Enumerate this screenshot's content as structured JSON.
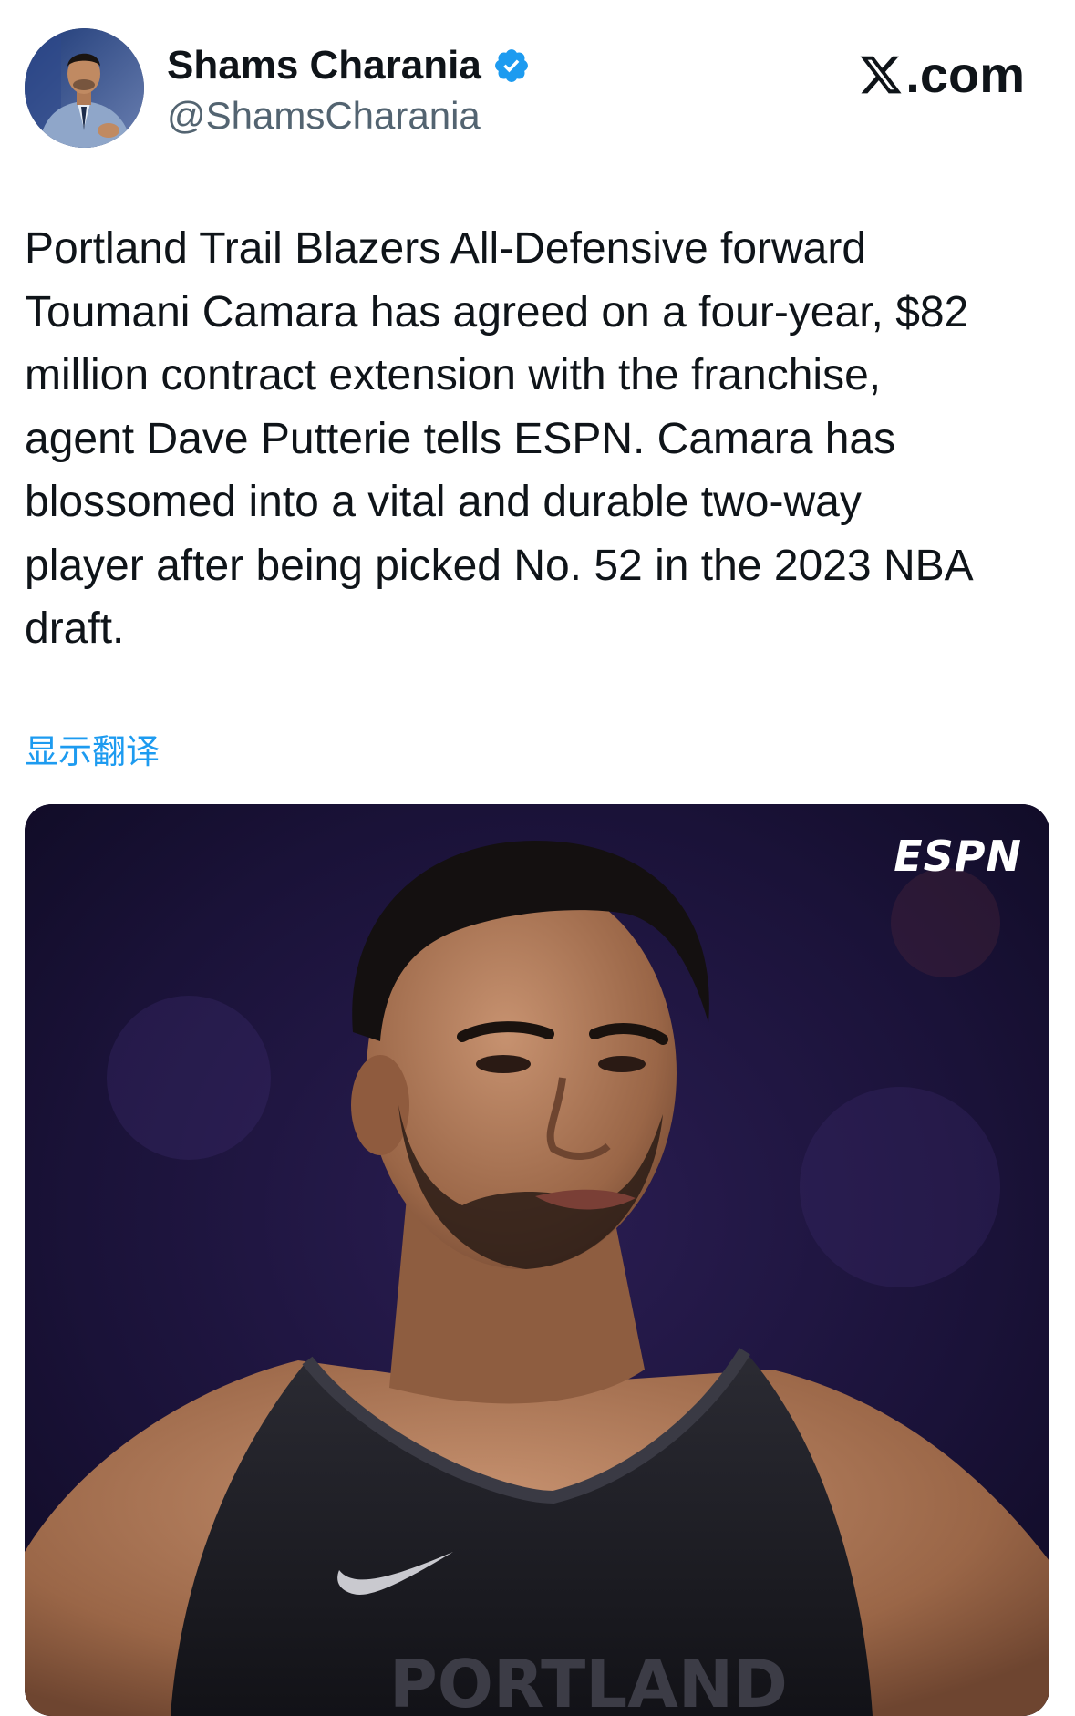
{
  "author": {
    "display_name": "Shams Charania",
    "handle": "@ShamsCharania",
    "verified": true,
    "avatar_icon": "profile-photo"
  },
  "brand": {
    "site_label": ".com",
    "logo_icon": "x-logo-icon"
  },
  "tweet": {
    "text": "Portland Trail Blazers All-Defensive forward\nToumani Camara has agreed on a four-year, $82\nmillion contract extension with the franchise,\nagent Dave Putterie tells ESPN. Camara has\nblossomed into a vital and durable two-way\nplayer after being picked No. 52 in the 2023 NBA\ndraft.",
    "translate_label": "显示翻译"
  },
  "media": {
    "watermark": "ESPN",
    "image_icon": "player-photo",
    "jersey_text": "PORTLAND"
  },
  "colors": {
    "link": "#1d9bf0",
    "verified": "#1d9bf0",
    "text": "#0f1419",
    "secondary": "#536471"
  }
}
